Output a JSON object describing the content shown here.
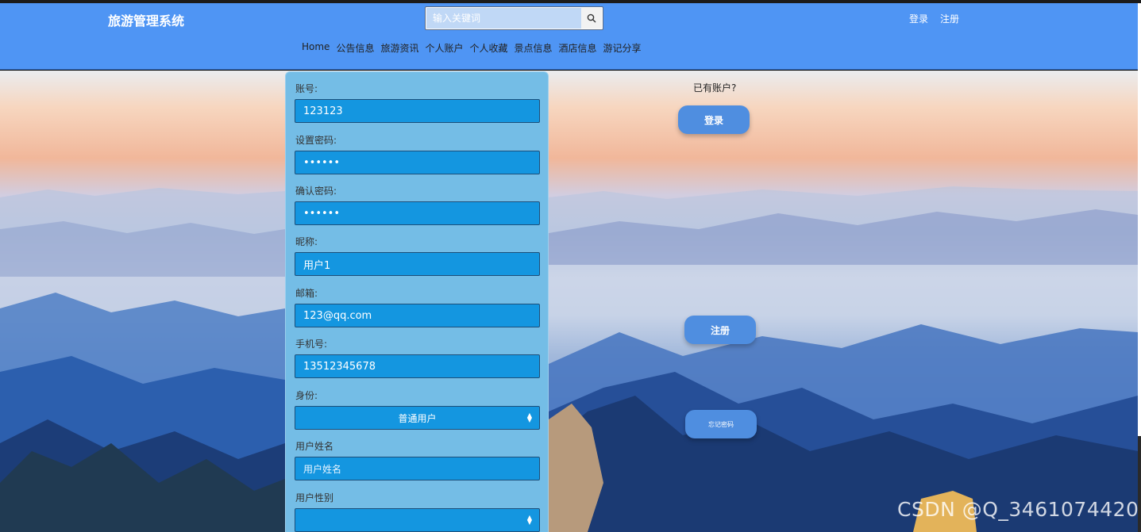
{
  "header": {
    "brand": "旅游管理系统",
    "search_placeholder": "输入关键词",
    "login_label": "登录",
    "register_label": "注册",
    "search_icon": "search-icon"
  },
  "nav": [
    "Home",
    "公告信息",
    "旅游资讯",
    "个人账户",
    "个人收藏",
    "景点信息",
    "酒店信息",
    "游记分享"
  ],
  "form": {
    "account_label": "账号:",
    "account_value": "123123",
    "password_label": "设置密码:",
    "password_value": "••••••",
    "confirm_label": "确认密码:",
    "confirm_value": "••••••",
    "nickname_label": "昵称:",
    "nickname_value": "用户1",
    "email_label": "邮箱:",
    "email_value": "123@qq.com",
    "phone_label": "手机号:",
    "phone_value": "13512345678",
    "identity_label": "身份:",
    "identity_value": "普通用户",
    "username_label": "用户姓名",
    "username_placeholder": "用户姓名",
    "gender_label": "用户性别",
    "gender_value": ""
  },
  "side": {
    "hint": "已有账户?",
    "login_button": "登录",
    "register_button": "注册",
    "forgot_button": "忘记密码"
  },
  "watermark": "CSDN @Q_3461074420",
  "colors": {
    "header_bg": "#4f95f4",
    "panel_bg": "#74bde6",
    "field_bg": "#1496e0",
    "button_bg": "#4f8ee0"
  }
}
